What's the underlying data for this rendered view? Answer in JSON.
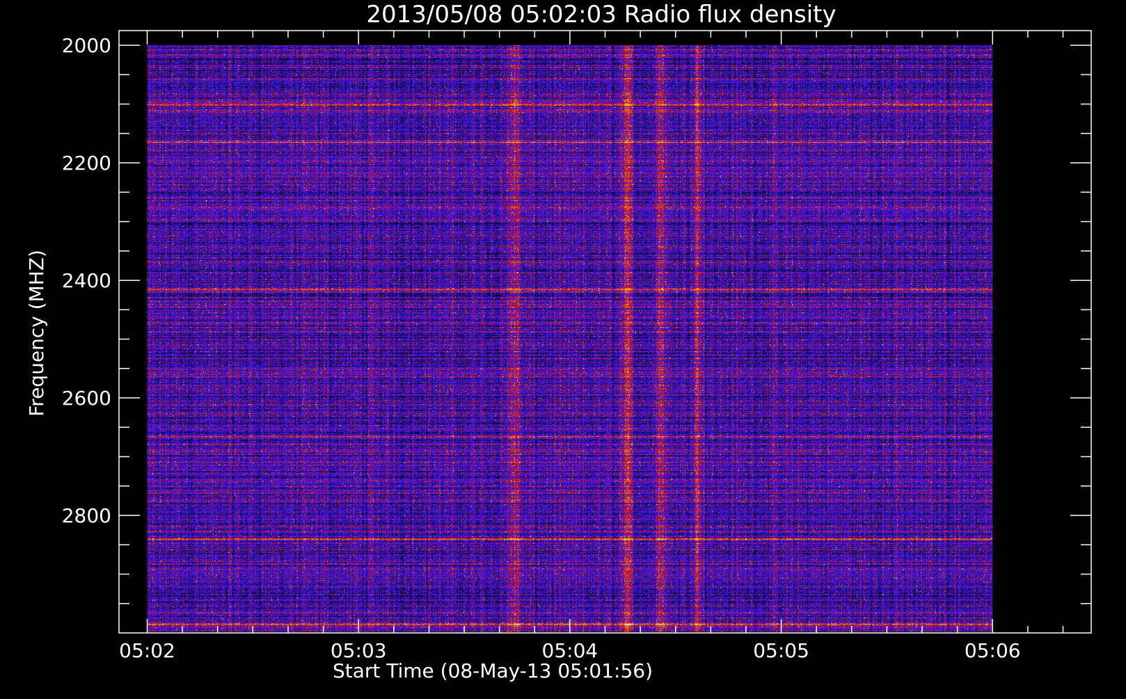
{
  "chart_data": {
    "type": "heatmap",
    "title": "2013/05/08 05:02:03 Radio flux density",
    "xlabel": "Start Time (08-May-13 05:01:56)",
    "ylabel": "Frequency (MHZ)",
    "x_ticks": [
      "05:02",
      "05:03",
      "05:04",
      "05:05",
      "05:06"
    ],
    "y_ticks": [
      "2000",
      "2200",
      "2400",
      "2600",
      "2800"
    ],
    "x_range_seconds": [
      -4,
      272
    ],
    "y_range_mhz": [
      1975,
      3000
    ],
    "data_time_range_seconds": [
      4,
      244
    ],
    "data_freq_range_mhz": [
      2000,
      2998
    ],
    "colormap": [
      "#000000",
      "#1a0a6e",
      "#2a1aff",
      "#6a10c0",
      "#b01020",
      "#ff3a10",
      "#ff9a20",
      "#ffff80"
    ],
    "bursts": [
      {
        "time_s": 160,
        "freq_range_mhz": [
          2090,
          2960
        ]
      },
      {
        "time_s": 108,
        "freq_range_mhz": [
          2150,
          2900
        ]
      },
      {
        "time_s": 150,
        "freq_range_mhz": [
          2080,
          2480
        ]
      },
      {
        "time_s": 140,
        "freq_range_mhz": [
          2300,
          2450
        ]
      }
    ],
    "bright_bands_mhz": [
      2100,
      2165,
      2415,
      2665,
      2840,
      2985
    ]
  }
}
